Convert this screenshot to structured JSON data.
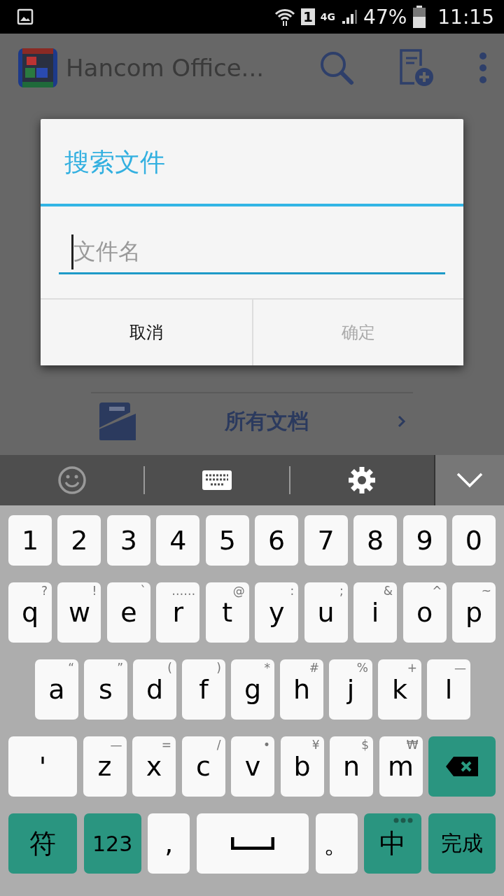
{
  "status_bar": {
    "network": "4G",
    "sim": "1",
    "battery": "47%",
    "time": "11:15"
  },
  "app_bar": {
    "title": "Hancom Office..."
  },
  "list_items": [
    {
      "label": "所有文档"
    }
  ],
  "dialog": {
    "title": "搜索文件",
    "field": {
      "placeholder": "文件名"
    },
    "buttons": [
      {
        "label": "取消",
        "disabled": false
      },
      {
        "label": "确定",
        "disabled": true
      }
    ]
  },
  "keyboard": {
    "rows": [
      {
        "keys": [
          {
            "kind": "char",
            "label": "1"
          },
          {
            "kind": "char",
            "label": "2"
          },
          {
            "kind": "char",
            "label": "3"
          },
          {
            "kind": "char",
            "label": "4"
          },
          {
            "kind": "char",
            "label": "5"
          },
          {
            "kind": "char",
            "label": "6"
          },
          {
            "kind": "char",
            "label": "7"
          },
          {
            "kind": "char",
            "label": "8"
          },
          {
            "kind": "char",
            "label": "9"
          },
          {
            "kind": "char",
            "label": "0"
          }
        ]
      },
      {
        "keys": [
          {
            "kind": "char",
            "label": "q",
            "hint": "?"
          },
          {
            "kind": "char",
            "label": "w",
            "hint": "!"
          },
          {
            "kind": "char",
            "label": "e",
            "hint": "`"
          },
          {
            "kind": "char",
            "label": "r",
            "hint": "……"
          },
          {
            "kind": "char",
            "label": "t",
            "hint": "@"
          },
          {
            "kind": "char",
            "label": "y",
            "hint": ":"
          },
          {
            "kind": "char",
            "label": "u",
            "hint": ";"
          },
          {
            "kind": "char",
            "label": "i",
            "hint": "&"
          },
          {
            "kind": "char",
            "label": "o",
            "hint": "^"
          },
          {
            "kind": "char",
            "label": "p",
            "hint": "~"
          }
        ]
      },
      {
        "keys": [
          {
            "kind": "char",
            "label": "a",
            "hint": "“"
          },
          {
            "kind": "char",
            "label": "s",
            "hint": "”"
          },
          {
            "kind": "char",
            "label": "d",
            "hint": "("
          },
          {
            "kind": "char",
            "label": "f",
            "hint": ")"
          },
          {
            "kind": "char",
            "label": "g",
            "hint": "*"
          },
          {
            "kind": "char",
            "label": "h",
            "hint": "#"
          },
          {
            "kind": "char",
            "label": "j",
            "hint": "%"
          },
          {
            "kind": "char",
            "label": "k",
            "hint": "+"
          },
          {
            "kind": "char",
            "label": "l",
            "hint": "—"
          }
        ]
      },
      {
        "keys": [
          {
            "kind": "char",
            "label": "'"
          },
          {
            "kind": "char",
            "label": "z",
            "hint": "—"
          },
          {
            "kind": "char",
            "label": "x",
            "hint": "="
          },
          {
            "kind": "char",
            "label": "c",
            "hint": "/"
          },
          {
            "kind": "char",
            "label": "v",
            "hint": "•"
          },
          {
            "kind": "char",
            "label": "b",
            "hint": "¥"
          },
          {
            "kind": "char",
            "label": "n",
            "hint": "$"
          },
          {
            "kind": "char",
            "label": "m",
            "hint": "₩"
          },
          {
            "kind": "delete"
          }
        ]
      },
      {
        "keys": [
          {
            "kind": "func",
            "label": "符"
          },
          {
            "kind": "func",
            "label": "123"
          },
          {
            "kind": "char",
            "label": ","
          },
          {
            "kind": "space"
          },
          {
            "kind": "char",
            "label": "。"
          },
          {
            "kind": "func",
            "label": "中",
            "more": true
          },
          {
            "kind": "func",
            "label": "完成"
          }
        ]
      }
    ]
  }
}
